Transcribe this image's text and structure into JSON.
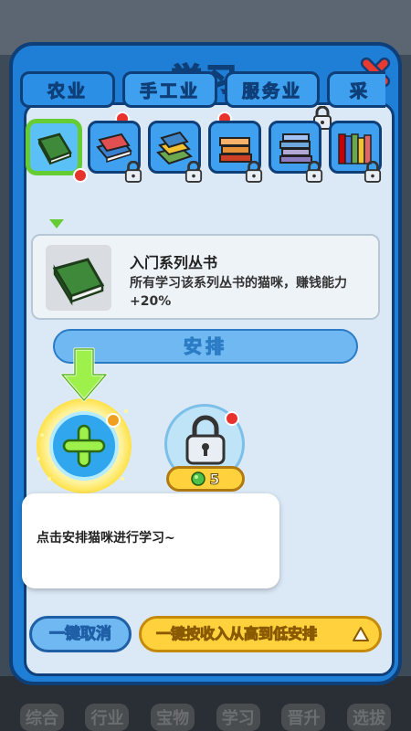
{
  "title": "学习",
  "tabs": [
    {
      "label": "农业",
      "dot": true,
      "locked": false
    },
    {
      "label": "手工业",
      "dot": true,
      "locked": false
    },
    {
      "label": "服务业",
      "dot": false,
      "locked": true
    },
    {
      "label": "采",
      "dot": false,
      "locked": false
    }
  ],
  "books": [
    {
      "name": "green-book",
      "selected": true,
      "locked": false
    },
    {
      "name": "red-blue-books",
      "locked": true
    },
    {
      "name": "stacked-books",
      "locked": true
    },
    {
      "name": "orange-books",
      "locked": true
    },
    {
      "name": "purple-books",
      "locked": true
    },
    {
      "name": "colorful-books",
      "locked": true
    }
  ],
  "info": {
    "title": "入门系列丛书",
    "description": "所有学习该系列丛书的猫咪，赚钱能力+20%"
  },
  "arrange_label": "安排",
  "locked_slot_price": "5",
  "tooltip_text": "点击安排猫咪进行学习~",
  "buttons": {
    "cancel": "一键取消",
    "auto_arrange": "一键按收入从高到低安排"
  },
  "bottom_nav": [
    "综合",
    "行业",
    "宝物",
    "学习",
    "晋升",
    "选拔"
  ],
  "colors": {
    "panel_blue": "#1f7fd6",
    "accent_yellow": "#ffd23d",
    "selection_green": "#66cc33"
  }
}
